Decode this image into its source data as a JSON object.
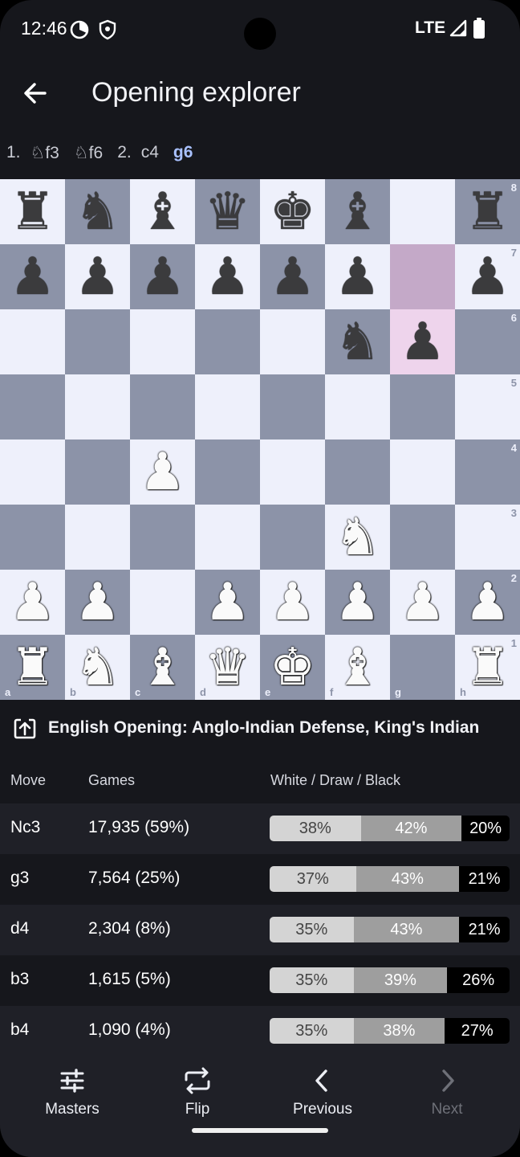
{
  "status_bar": {
    "time": "12:46",
    "network": "LTE"
  },
  "app_bar": {
    "title": "Opening explorer"
  },
  "move_list": [
    {
      "text": "1.",
      "kind": "num"
    },
    {
      "text": "♘f3",
      "kind": "move"
    },
    {
      "text": "♘f6",
      "kind": "move"
    },
    {
      "text": "2.",
      "kind": "num"
    },
    {
      "text": "c4",
      "kind": "move"
    },
    {
      "text": "g6",
      "kind": "current"
    }
  ],
  "board": {
    "ranks": [
      "8",
      "7",
      "6",
      "5",
      "4",
      "3",
      "2",
      "1"
    ],
    "files": [
      "a",
      "b",
      "c",
      "d",
      "e",
      "f",
      "g",
      "h"
    ],
    "pieces": {
      "a8": "r",
      "b8": "n",
      "c8": "b",
      "d8": "q",
      "e8": "k",
      "f8": "b",
      "h8": "r",
      "a7": "p",
      "b7": "p",
      "c7": "p",
      "d7": "p",
      "e7": "p",
      "f7": "p",
      "h7": "p",
      "f6": "n",
      "g6": "p",
      "c4": "P",
      "f3": "N",
      "a2": "P",
      "b2": "P",
      "d2": "P",
      "e2": "P",
      "f2": "P",
      "g2": "P",
      "h2": "P",
      "a1": "R",
      "b1": "N",
      "c1": "B",
      "d1": "Q",
      "e1": "K",
      "f1": "B",
      "h1": "R"
    },
    "last_move": [
      "g7",
      "g6"
    ]
  },
  "opening": {
    "name": "English Opening: Anglo-Indian Defense, King's Indian"
  },
  "table": {
    "headers": {
      "move": "Move",
      "games": "Games",
      "results": "White / Draw / Black"
    },
    "rows": [
      {
        "move": "Nc3",
        "games": "17,935 (59%)",
        "white": "38%",
        "draw": "42%",
        "black": "20%",
        "w": 38,
        "d": 42,
        "b": 20
      },
      {
        "move": "g3",
        "games": "7,564 (25%)",
        "white": "37%",
        "draw": "43%",
        "black": "21%",
        "w": 36,
        "d": 43,
        "b": 21
      },
      {
        "move": "d4",
        "games": "2,304 (8%)",
        "white": "35%",
        "draw": "43%",
        "black": "21%",
        "w": 35,
        "d": 44,
        "b": 21
      },
      {
        "move": "b3",
        "games": "1,615 (5%)",
        "white": "35%",
        "draw": "39%",
        "black": "26%",
        "w": 35,
        "d": 39,
        "b": 26
      },
      {
        "move": "b4",
        "games": "1,090 (4%)",
        "white": "35%",
        "draw": "38%",
        "black": "27%",
        "w": 35,
        "d": 38,
        "b": 27
      }
    ]
  },
  "bottom_nav": {
    "masters": "Masters",
    "flip": "Flip",
    "previous": "Previous",
    "next": "Next"
  }
}
